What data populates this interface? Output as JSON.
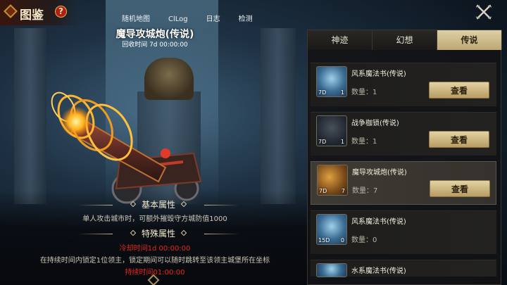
{
  "header": {
    "title": "图鉴",
    "help_icon": "question-mark-icon",
    "tabs": [
      "随机地图",
      "ClLog",
      "日志",
      "检测"
    ],
    "close_icon": "close-x-icon"
  },
  "item": {
    "name": "魔导攻城炮(传说)",
    "recycle_time": "回收时间 7d 00:00:00"
  },
  "attributes": {
    "basic_title": "基本属性",
    "basic_desc": "单人攻击城市时，可额外摧毁守方城防值1000",
    "special_title": "特殊属性",
    "cooldown": "冷却时间1d 00:00:00",
    "special_desc": "在持续时间内锁定1位领主，锁定期间可以随时跳转至该领主城堡所在坐标",
    "duration": "持续时间01:00:00"
  },
  "panel": {
    "tabs": [
      {
        "label": "神迹",
        "active": false
      },
      {
        "label": "幻想",
        "active": false
      },
      {
        "label": "传说",
        "active": true
      }
    ],
    "view_label": "查看",
    "items": [
      {
        "name": "风系魔法书(传说)",
        "qty": "数量：1",
        "left_badge": "7D",
        "right_badge": "1",
        "thumb": "blue"
      },
      {
        "name": "战争枷锁(传说)",
        "qty": "数量：1",
        "left_badge": "7D",
        "right_badge": "1",
        "thumb": "dark"
      },
      {
        "name": "魔导攻城炮(传说)",
        "qty": "数量：7",
        "left_badge": "7D",
        "right_badge": "7",
        "thumb": "gold"
      },
      {
        "name": "风系魔法书(传说)",
        "qty": "数量：0",
        "left_badge": "15D",
        "right_badge": "0",
        "thumb": "blue"
      },
      {
        "name": "水系魔法书(传说)",
        "qty": "",
        "left_badge": "",
        "right_badge": "",
        "thumb": "blue"
      }
    ]
  },
  "colors": {
    "accent_gold": "#bda874",
    "warning_red": "#e8281e"
  }
}
